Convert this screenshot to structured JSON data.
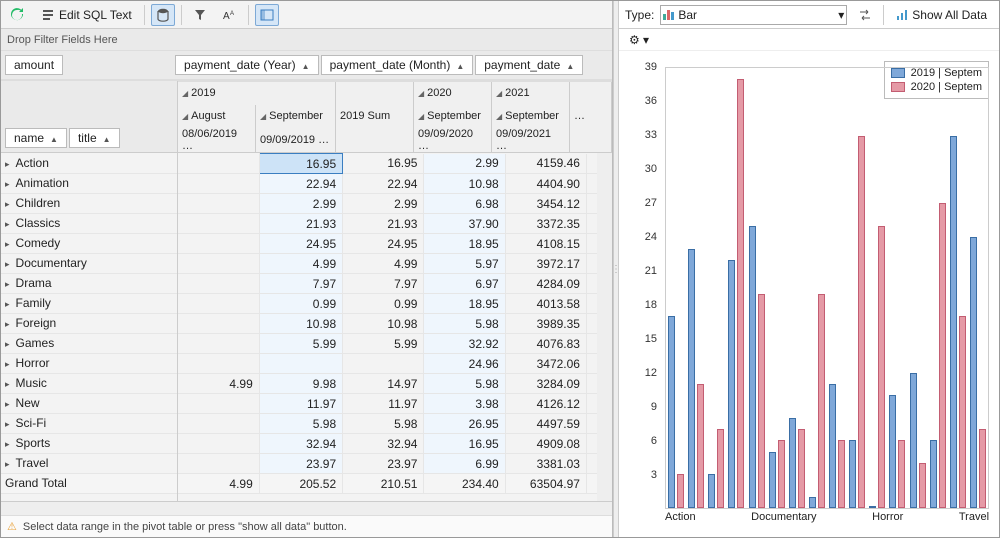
{
  "toolbar": {
    "refresh": "Refresh",
    "edit_sql": "Edit SQL Text",
    "show_all_data": "Show All Data"
  },
  "type_label": "Type:",
  "chart_type": "Bar",
  "filter_drop_prompt": "Drop Filter Fields Here",
  "data_field": "amount",
  "col_fields": [
    "payment_date (Year)",
    "payment_date (Month)",
    "payment_date"
  ],
  "row_fields": [
    "name",
    "title"
  ],
  "col_years": [
    "2019",
    "2020",
    "2021"
  ],
  "col_months": [
    "August",
    "September",
    "2019 Sum",
    "September",
    "September",
    "…"
  ],
  "col_dates": [
    "08/06/2019 …",
    "09/09/2019 …",
    "",
    "09/09/2020 …",
    "09/09/2021 …",
    ""
  ],
  "legend": [
    "2019 | Septem",
    "2020 | Septem"
  ],
  "warn_text": "Select data range in the pivot table or press \"show all data\" button.",
  "rows": [
    {
      "name": "Action",
      "v": [
        "",
        "16.95",
        "16.95",
        "2.99",
        "4159.46"
      ]
    },
    {
      "name": "Animation",
      "v": [
        "",
        "22.94",
        "22.94",
        "10.98",
        "4404.90"
      ]
    },
    {
      "name": "Children",
      "v": [
        "",
        "2.99",
        "2.99",
        "6.98",
        "3454.12"
      ]
    },
    {
      "name": "Classics",
      "v": [
        "",
        "21.93",
        "21.93",
        "37.90",
        "3372.35"
      ]
    },
    {
      "name": "Comedy",
      "v": [
        "",
        "24.95",
        "24.95",
        "18.95",
        "4108.15"
      ]
    },
    {
      "name": "Documentary",
      "v": [
        "",
        "4.99",
        "4.99",
        "5.97",
        "3972.17"
      ]
    },
    {
      "name": "Drama",
      "v": [
        "",
        "7.97",
        "7.97",
        "6.97",
        "4284.09"
      ]
    },
    {
      "name": "Family",
      "v": [
        "",
        "0.99",
        "0.99",
        "18.95",
        "4013.58"
      ]
    },
    {
      "name": "Foreign",
      "v": [
        "",
        "10.98",
        "10.98",
        "5.98",
        "3989.35"
      ]
    },
    {
      "name": "Games",
      "v": [
        "",
        "5.99",
        "5.99",
        "32.92",
        "4076.83"
      ]
    },
    {
      "name": "Horror",
      "v": [
        "",
        "",
        "",
        "24.96",
        "3472.06"
      ]
    },
    {
      "name": "Music",
      "v": [
        "4.99",
        "9.98",
        "14.97",
        "5.98",
        "3284.09"
      ]
    },
    {
      "name": "New",
      "v": [
        "",
        "11.97",
        "11.97",
        "3.98",
        "4126.12"
      ]
    },
    {
      "name": "Sci-Fi",
      "v": [
        "",
        "5.98",
        "5.98",
        "26.95",
        "4497.59"
      ]
    },
    {
      "name": "Sports",
      "v": [
        "",
        "32.94",
        "32.94",
        "16.95",
        "4909.08"
      ]
    },
    {
      "name": "Travel",
      "v": [
        "",
        "23.97",
        "23.97",
        "6.99",
        "3381.03"
      ]
    }
  ],
  "grand_total": {
    "label": "Grand Total",
    "v": [
      "4.99",
      "205.52",
      "210.51",
      "234.40",
      "63504.97"
    ]
  },
  "chart_data": {
    "type": "bar",
    "ylim": [
      0,
      39
    ],
    "categories": [
      "Action",
      "Animation",
      "Children",
      "Classics",
      "Comedy",
      "Documentary",
      "Drama",
      "Family",
      "Foreign",
      "Games",
      "Horror",
      "Music",
      "New",
      "Sci-Fi",
      "Sports",
      "Travel"
    ],
    "xticks_shown": [
      "Action",
      "Documentary",
      "Horror",
      "Travel"
    ],
    "series": [
      {
        "name": "2019 | Septem",
        "color": "#7fa8d9",
        "values": [
          17,
          23,
          3,
          22,
          25,
          5,
          8,
          1,
          11,
          6,
          0,
          10,
          12,
          6,
          33,
          24
        ]
      },
      {
        "name": "2020 | Septem",
        "color": "#e59aa6",
        "values": [
          3,
          11,
          7,
          38,
          19,
          6,
          7,
          19,
          6,
          33,
          25,
          6,
          4,
          27,
          17,
          7
        ]
      }
    ]
  },
  "yticks": [
    3,
    6,
    9,
    12,
    15,
    18,
    21,
    24,
    27,
    30,
    33,
    36,
    39
  ]
}
